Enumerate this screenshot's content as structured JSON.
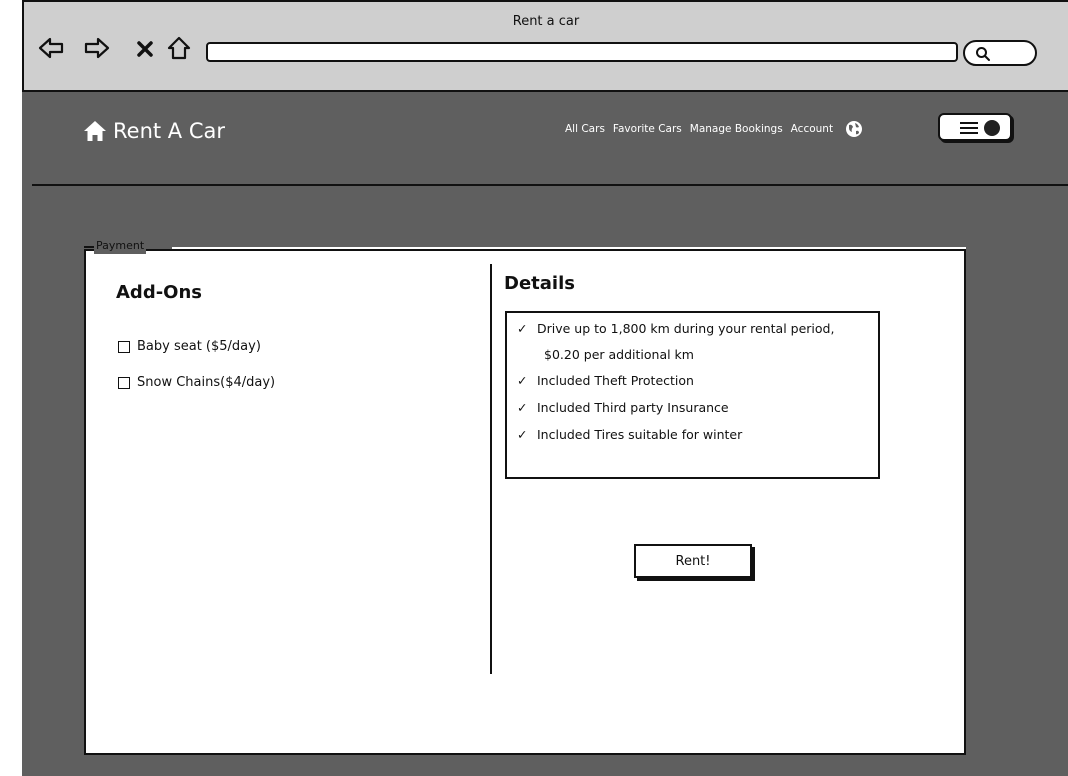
{
  "window": {
    "title": "Rent a car"
  },
  "browser": {
    "back_icon": "arrow-left-outline",
    "forward_icon": "arrow-right-outline",
    "stop_icon": "x-mark",
    "home_icon": "house-outline",
    "search_icon": "magnifier",
    "url_value": ""
  },
  "header": {
    "brand": "Rent A Car",
    "nav": [
      "All Cars",
      "Favorite Cars",
      "Manage Bookings",
      "Account"
    ],
    "globe_icon": "globe",
    "menu_icon": "hamburger",
    "toggle_state": "on"
  },
  "payment": {
    "legend": "Payment",
    "addons": {
      "title": "Add-Ons",
      "options": [
        {
          "label": "Baby seat ($5/day)",
          "checked": false
        },
        {
          "label": "Snow Chains($4/day)",
          "checked": false
        }
      ]
    },
    "details": {
      "title": "Details",
      "items": [
        "Drive up to 1,800 km during your rental period,",
        "Included Theft Protection",
        "Included Third party Insurance",
        "Included Tires suitable for winter"
      ],
      "item_continuation": "$0.20 per additional km"
    },
    "rent_button": "Rent!"
  },
  "colors": {
    "app_background": "#5f5f5f",
    "chrome_background": "#cfcfcf",
    "panel_background": "#ffffff",
    "ink": "#111111"
  }
}
